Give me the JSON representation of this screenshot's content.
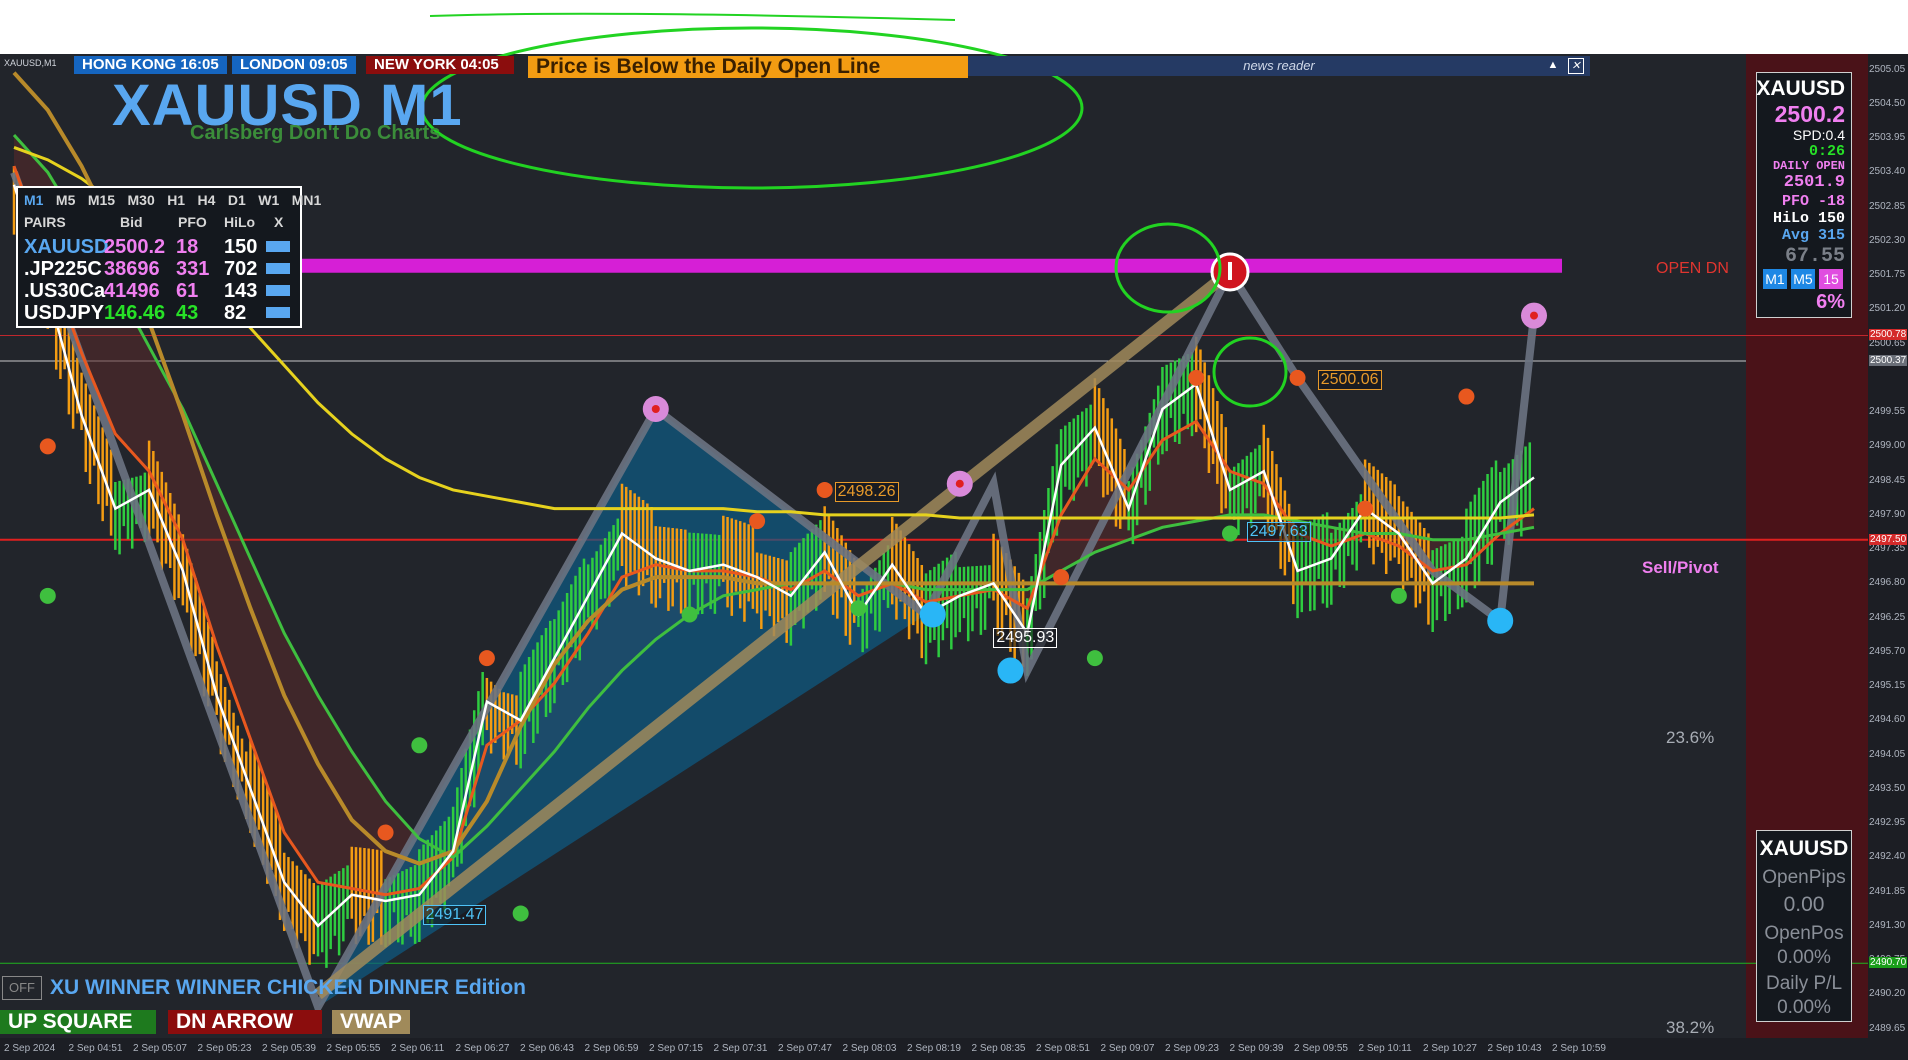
{
  "window": {
    "title": "XAUUSD,M1"
  },
  "sessions": [
    {
      "label": "HONG KONG  16:05"
    },
    {
      "label": "LONDON  09:05"
    },
    {
      "label": "NEW YORK  04:05"
    }
  ],
  "alert": "Price is Below the Daily Open Line",
  "news": {
    "label": "news reader",
    "up_icon": "triangle-up-icon",
    "close_icon": "close-box-icon"
  },
  "title": "XAUUSD M1",
  "brand": "Carlsberg Don't Do Charts",
  "tf_panel": {
    "timeframes": [
      "M1",
      "M5",
      "M15",
      "M30",
      "H1",
      "H4",
      "D1",
      "W1",
      "MN1"
    ],
    "active": "M1",
    "headers": [
      "PAIRS",
      "Bid",
      "PFO",
      "HiLo",
      "X"
    ],
    "rows": [
      {
        "pair": "XAUUSD",
        "bid": "2500.2",
        "pfo": "18",
        "hilo": "150",
        "pair_color": "#59a7f0",
        "bid_color": "#f07ff0",
        "pfo_color": "#f07ff0"
      },
      {
        "pair": ".JP225C",
        "bid": "38696",
        "pfo": "331",
        "hilo": "702",
        "pair_color": "#ffffff",
        "bid_color": "#f07ff0",
        "pfo_color": "#f07ff0"
      },
      {
        "pair": ".US30Ca",
        "bid": "41496",
        "pfo": "61",
        "hilo": "143",
        "pair_color": "#ffffff",
        "bid_color": "#f07ff0",
        "pfo_color": "#f07ff0"
      },
      {
        "pair": "USDJPY",
        "bid": "146.46",
        "pfo": "43",
        "hilo": "82",
        "pair_color": "#ffffff",
        "bid_color": "#27e127",
        "pfo_color": "#27e127"
      }
    ]
  },
  "right_panel": {
    "symbol": "XAUUSD",
    "price": "2500.2",
    "spread": "SPD:0.4",
    "timer": "0:26",
    "daily_open_label": "DAILY OPEN",
    "daily_open": "2501.9",
    "pfo": "PFO   -18",
    "hilo": "HiLo  150",
    "avg": "Avg   315",
    "value": "67.55",
    "tf_buttons": [
      "M1",
      "M5",
      "15"
    ],
    "percent": "6%"
  },
  "account_panel": {
    "symbol": "XAUUSD",
    "open_pips_label": "OpenPips",
    "open_pips": "0.00",
    "open_pos_label": "OpenPos",
    "open_pos": "0.00%",
    "daily_pl_label": "Daily P/L",
    "daily_pl": "0.00%"
  },
  "labels": {
    "open_dn": "OPEN DN",
    "sell_pivot": "Sell/Pivot",
    "fib_236": "23.6%",
    "fib_382": "38.2%",
    "edition": "XU WINNER WINNER CHICKEN DINNER Edition",
    "off": "OFF",
    "up_square": "UP SQUARE",
    "dn_arrow": "DN ARROW",
    "vwap": "VWAP"
  },
  "chart_data": {
    "type": "line",
    "symbol": "XAUUSD",
    "timeframe": "M1",
    "x_labels": [
      "2 Sep 2024",
      "2 Sep 04:51",
      "2 Sep 05:07",
      "2 Sep 05:23",
      "2 Sep 05:39",
      "2 Sep 05:55",
      "2 Sep 06:11",
      "2 Sep 06:27",
      "2 Sep 06:43",
      "2 Sep 06:59",
      "2 Sep 07:15",
      "2 Sep 07:31",
      "2 Sep 07:47",
      "2 Sep 08:03",
      "2 Sep 08:19",
      "2 Sep 08:35",
      "2 Sep 08:51",
      "2 Sep 09:07",
      "2 Sep 09:23",
      "2 Sep 09:39",
      "2 Sep 09:55",
      "2 Sep 10:11",
      "2 Sep 10:27",
      "2 Sep 10:43",
      "2 Sep 10:59"
    ],
    "ylim": [
      2489.5,
      2505.3
    ],
    "y_ticks": [
      "2505.05",
      "2504.50",
      "2503.95",
      "2503.40",
      "2502.85",
      "2502.30",
      "2501.75",
      "2501.20",
      "2500.65",
      "2500.37",
      "2499.55",
      "2499.00",
      "2498.45",
      "2497.90",
      "2497.35",
      "2496.80",
      "2496.25",
      "2495.70",
      "2495.15",
      "2494.60",
      "2494.05",
      "2493.50",
      "2492.95",
      "2492.40",
      "2491.85",
      "2491.30",
      "2490.75",
      "2490.20",
      "2489.65"
    ],
    "price_tags": [
      {
        "value": "2500.78",
        "color": "#d42a2a"
      },
      {
        "value": "2500.37",
        "color": "#6a6f78"
      },
      {
        "value": "2497.50",
        "color": "#d42a2a"
      },
      {
        "value": "2490.70",
        "color": "#1a9e1a"
      }
    ],
    "levels": {
      "daily_open": 2501.9,
      "red_upper": 2500.78,
      "current_bid": 2500.37,
      "sell_pivot": 2497.5,
      "green_low": 2490.7
    },
    "series": [
      {
        "name": "Close",
        "values": [
          2503.2,
          2501.5,
          2499.5,
          2498.0,
          2498.3,
          2497.0,
          2495.0,
          2493.5,
          2492.0,
          2491.3,
          2491.8,
          2491.7,
          2491.8,
          2492.5,
          2494.9,
          2494.6,
          2495.6,
          2496.6,
          2497.6,
          2497.2,
          2497.0,
          2497.1,
          2496.9,
          2496.6,
          2497.3,
          2496.3,
          2497.1,
          2496.3,
          2496.6,
          2496.8,
          2496.0,
          2498.7,
          2499.3,
          2498.0,
          2499.6,
          2500.0,
          2498.3,
          2498.6,
          2497.0,
          2497.2,
          2498.0,
          2497.6,
          2496.8,
          2497.2,
          2498.1,
          2498.5
        ]
      },
      {
        "name": "Fast MA",
        "values": [
          2503.5,
          2502.0,
          2500.5,
          2499.2,
          2498.6,
          2497.5,
          2495.8,
          2494.3,
          2492.8,
          2492.0,
          2491.9,
          2491.8,
          2491.9,
          2492.4,
          2494.2,
          2494.6,
          2495.2,
          2496.0,
          2496.9,
          2497.1,
          2497.0,
          2497.0,
          2496.9,
          2496.7,
          2497.0,
          2496.6,
          2496.8,
          2496.5,
          2496.6,
          2496.7,
          2496.4,
          2497.9,
          2498.8,
          2498.3,
          2499.1,
          2499.4,
          2498.6,
          2498.4,
          2497.6,
          2497.4,
          2497.6,
          2497.4,
          2497.0,
          2497.1,
          2497.6,
          2498.0
        ]
      },
      {
        "name": "Slow MA",
        "values": [
          2504.0,
          2503.4,
          2502.5,
          2501.6,
          2500.6,
          2499.6,
          2498.4,
          2497.2,
          2496.0,
          2495.0,
          2494.1,
          2493.3,
          2492.7,
          2492.4,
          2492.9,
          2493.5,
          2494.1,
          2494.8,
          2495.4,
          2495.9,
          2496.3,
          2496.6,
          2496.7,
          2496.8,
          2496.8,
          2496.8,
          2496.8,
          2496.7,
          2496.7,
          2496.7,
          2496.7,
          2497.0,
          2497.3,
          2497.5,
          2497.7,
          2497.8,
          2497.9,
          2497.9,
          2497.8,
          2497.7,
          2497.6,
          2497.6,
          2497.5,
          2497.5,
          2497.6,
          2497.7
        ]
      },
      {
        "name": "Yellow MA",
        "values": [
          2503.8,
          2503.6,
          2503.3,
          2502.9,
          2502.5,
          2502.0,
          2501.5,
          2500.9,
          2500.3,
          2499.7,
          2499.2,
          2498.8,
          2498.5,
          2498.3,
          2498.2,
          2498.1,
          2498.0,
          2498.0,
          2498.0,
          2498.0,
          2498.0,
          2498.0,
          2497.95,
          2497.95,
          2497.9,
          2497.9,
          2497.9,
          2497.9,
          2497.85,
          2497.85,
          2497.85,
          2497.85,
          2497.85,
          2497.85,
          2497.85,
          2497.85,
          2497.85,
          2497.85,
          2497.85,
          2497.85,
          2497.85,
          2497.85,
          2497.85,
          2497.85,
          2497.85,
          2497.9
        ]
      },
      {
        "name": "Brown MA",
        "values": [
          2505.0,
          2504.4,
          2503.5,
          2502.4,
          2501.0,
          2499.5,
          2497.9,
          2496.4,
          2495.0,
          2493.9,
          2493.0,
          2492.5,
          2492.3,
          2492.5,
          2493.3,
          2494.5,
          2495.5,
          2496.2,
          2496.7,
          2496.9,
          2496.9,
          2496.9,
          2496.8,
          2496.8,
          2496.8,
          2496.8,
          2496.8,
          2496.8,
          2496.8,
          2496.8,
          2496.8,
          2496.8,
          2496.8,
          2496.8,
          2496.8,
          2496.8,
          2496.8,
          2496.8,
          2496.8,
          2496.8,
          2496.8,
          2496.8,
          2496.8,
          2496.8,
          2496.8,
          2496.8
        ]
      }
    ],
    "zigzag": [
      {
        "t": 0,
        "p": 2503.4
      },
      {
        "t": 9,
        "p": 2490.0
      },
      {
        "t": 19,
        "p": 2499.6
      },
      {
        "t": 27,
        "p": 2496.3
      },
      {
        "t": 29,
        "p": 2498.4
      },
      {
        "t": 30,
        "p": 2495.4
      },
      {
        "t": 36,
        "p": 2501.8
      },
      {
        "t": 38,
        "p": 2500.1
      },
      {
        "t": 42,
        "p": 2497.0
      },
      {
        "t": 44,
        "p": 2496.2
      },
      {
        "t": 45,
        "p": 2501.1
      }
    ],
    "annotations": [
      {
        "text": "2498.26",
        "t": 24.0,
        "p": 2498.26,
        "color": "#e89a2a"
      },
      {
        "text": "2500.06",
        "t": 38.3,
        "p": 2500.06,
        "color": "#e89a2a"
      },
      {
        "text": "2497.63",
        "t": 36.2,
        "p": 2497.63,
        "color": "#4fc3f7"
      },
      {
        "text": "2495.93",
        "t": 28.7,
        "p": 2495.93,
        "color": "#ffffff"
      },
      {
        "text": "2491.47",
        "t": 11.8,
        "p": 2491.47,
        "color": "#4fc3f7"
      }
    ]
  }
}
